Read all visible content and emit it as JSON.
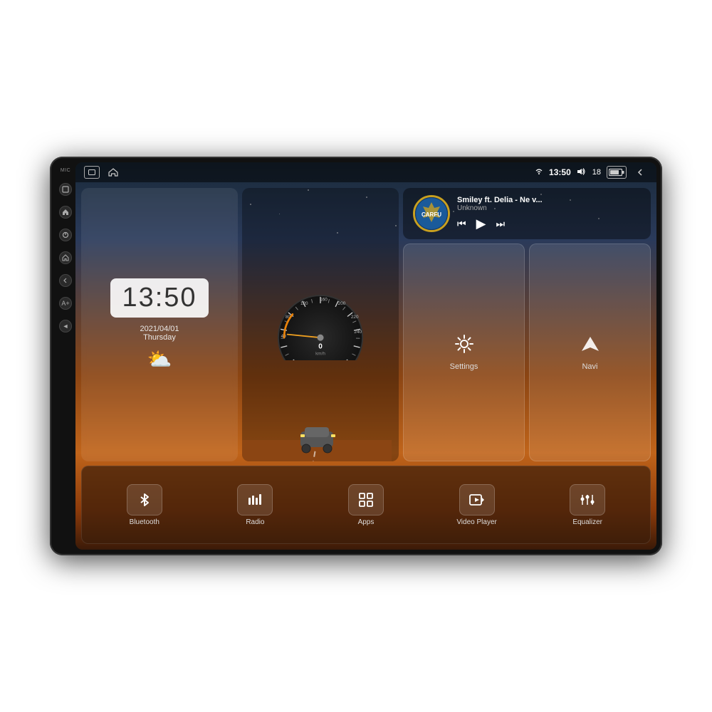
{
  "device": {
    "label": "Car Head Unit"
  },
  "statusBar": {
    "time": "13:50",
    "volume": "18",
    "wifi": "▼",
    "signal": "▲"
  },
  "clock": {
    "time": "13:50",
    "date": "2021/04/01",
    "day": "Thursday"
  },
  "speedometer": {
    "speed": "0",
    "unit": "km/h"
  },
  "music": {
    "title": "Smiley ft. Delia - Ne v...",
    "artist": "Unknown",
    "logoText": "CARFU"
  },
  "tiles": [
    {
      "id": "settings",
      "label": "Settings",
      "icon": "⚙"
    },
    {
      "id": "navi",
      "label": "Navi",
      "icon": "▲"
    }
  ],
  "bottomItems": [
    {
      "id": "bluetooth",
      "label": "Bluetooth"
    },
    {
      "id": "radio",
      "label": "Radio"
    },
    {
      "id": "apps",
      "label": "Apps"
    },
    {
      "id": "video-player",
      "label": "Video Player"
    },
    {
      "id": "equalizer",
      "label": "Equalizer"
    }
  ],
  "sideButtons": [
    {
      "id": "mic",
      "label": "MIC"
    },
    {
      "id": "back-home",
      "label": ""
    },
    {
      "id": "power",
      "label": ""
    },
    {
      "id": "home",
      "label": ""
    },
    {
      "id": "back",
      "label": ""
    },
    {
      "id": "vol-up",
      "label": ""
    },
    {
      "id": "vol-down",
      "label": ""
    }
  ]
}
